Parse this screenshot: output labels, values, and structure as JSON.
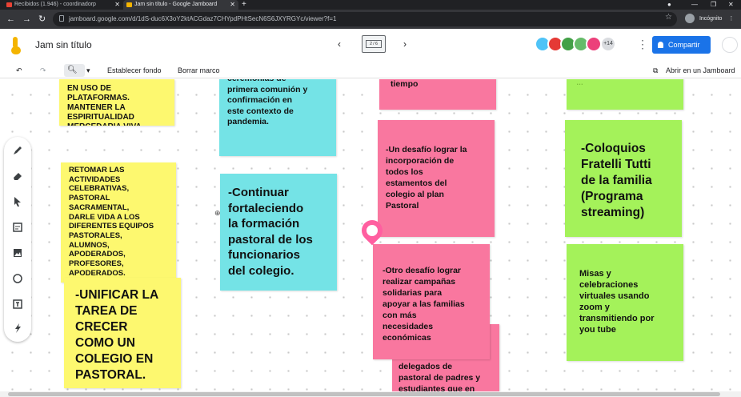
{
  "browser": {
    "tabs": [
      {
        "title": "Recibidos (1.946) - coordinadorp",
        "favicon_color": "#ea4335"
      },
      {
        "title": "Jam sin título - Google Jamboard",
        "favicon_color": "#f4b400"
      }
    ],
    "url": "jamboard.google.com/d/1dS-duc6X3oY2ktACGdaz7CHYpdPHtSecN6S6JXYRGYc/viewer?f=1",
    "incognito_label": "Incógnito"
  },
  "app": {
    "title": "Jam sin título",
    "frame_indicator": "2 / 6",
    "collaborators_more": "+14",
    "share_label": "Compartir",
    "brand_color": "#f4b400",
    "share_color": "#1a73e8"
  },
  "toolbar": {
    "set_background": "Establecer fondo",
    "clear_frame": "Borrar marco",
    "open_in_jamboard": "Abrir en un Jamboard"
  },
  "tools": [
    "pen-icon",
    "eraser-icon",
    "select-icon",
    "sticky-note-icon",
    "image-icon",
    "shape-icon",
    "text-box-icon",
    "laser-icon"
  ],
  "notes": [
    {
      "id": "n1",
      "color": "#fdf86f",
      "text": "EN USO DE\nPLATAFORMAS.\nMANTENER LA\nESPIRITUALIDAD\nMERCEDARIA VIVA\nSIENDO UN COLEGIO\nEN PASTORAL"
    },
    {
      "id": "n2",
      "color": "#fdf86f",
      "text": "RETOMAR LAS\nACTIVIDADES\nCELEBRATIVAS,\nPASTORAL\nSACRAMENTAL,\nDARLE VIDA A LOS\nDIFERENTES EQUIPOS\nPASTORALES,\nALUMNOS,\nAPODERADOS,\nPROFESORES,\nAPODERADOS."
    },
    {
      "id": "n3",
      "color": "#fdf86f",
      "text": "-UNIFICAR LA\nTAREA DE\nCRECER\nCOMO UN\nCOLEGIO EN\nPASTORAL."
    },
    {
      "id": "n4",
      "color": "#74e3e6",
      "text": "ceremonias de\nprimera comunión y\nconfirmación en\neste contexto de\npandemia."
    },
    {
      "id": "n5",
      "color": "#74e3e6",
      "text": "-Continuar\nfortaleciendo\nla formación\npastoral de los\nfuncionarios\ndel colegio."
    },
    {
      "id": "n6",
      "color": "#f9779f",
      "text": "tiempo"
    },
    {
      "id": "n7",
      "color": "#f9779f",
      "text": "-Un desafío lograr la\nincorporación de\ntodos los\nestamentos del\ncolegio al plan\nPastoral"
    },
    {
      "id": "n8",
      "color": "#f9779f",
      "text": "-Otro desafío lograr\nrealizar campañas\nsolidarias para\napoyar a las familias\ncon más\nnecesidades\neconómicas"
    },
    {
      "id": "n9",
      "color": "#f9779f",
      "text": "delegados de\npastoral de padres y\nestudiantes que en"
    },
    {
      "id": "n10",
      "color": "#a4f25a",
      "text": "…"
    },
    {
      "id": "n11",
      "color": "#a4f25a",
      "text": "-Coloquios\nFratelli Tutti\nde la familia\n(Programa\nstreaming)"
    },
    {
      "id": "n12",
      "color": "#a4f25a",
      "text": "Misas y\ncelebraciones\nvirtuales usando\nzoom y\ntransmitiendo por\nyou tube"
    }
  ]
}
